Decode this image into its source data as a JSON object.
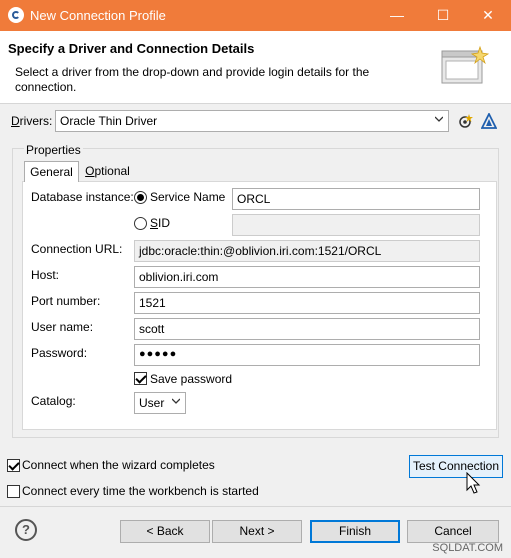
{
  "window": {
    "title": "New Connection Profile",
    "minimize": "—",
    "maximize": "☐",
    "close": "✕"
  },
  "header": {
    "title": "Specify a Driver and Connection Details",
    "description": "Select a driver from the drop-down and provide login details for the connection."
  },
  "drivers": {
    "label": "Drivers:",
    "accel": "D",
    "label_rest": "rivers:",
    "value": "Oracle Thin Driver"
  },
  "properties": {
    "group_label": "Properties",
    "tabs": {
      "general": "General",
      "optional": "Optional",
      "optional_accel": "O",
      "optional_rest": "ptional"
    },
    "database_instance_label": "Database instance:",
    "service_name_label": "Service Name",
    "service_name_value": "ORCL",
    "sid_label": "SID",
    "sid_accel": "S",
    "sid_rest": "ID",
    "connection_url_label": "Connection URL:",
    "connection_url_value": "jdbc:oracle:thin:@oblivion.iri.com:1521/ORCL",
    "host_label": "Host:",
    "host_value": "oblivion.iri.com",
    "port_label": "Port number:",
    "port_value": "1521",
    "user_label": "User name:",
    "user_value": "scott",
    "password_label": "Password:",
    "password_value": "●●●●●",
    "save_password_label": "Save password",
    "save_password_checked": true,
    "catalog_label": "Catalog:",
    "catalog_value": "User"
  },
  "options": {
    "connect_when_completes": "Connect when the wizard completes",
    "connect_when_completes_checked": true,
    "connect_every_time": "Connect every time the workbench is started",
    "connect_every_time_checked": false
  },
  "buttons": {
    "test_connection": "Test Connection",
    "back": "< Back",
    "next": "Next >",
    "finish": "Finish",
    "cancel": "Cancel",
    "help": "?"
  },
  "watermark": "SQLDAT.COM",
  "colors": {
    "titlebar": "#f07b3a",
    "focus": "#0078d7"
  }
}
